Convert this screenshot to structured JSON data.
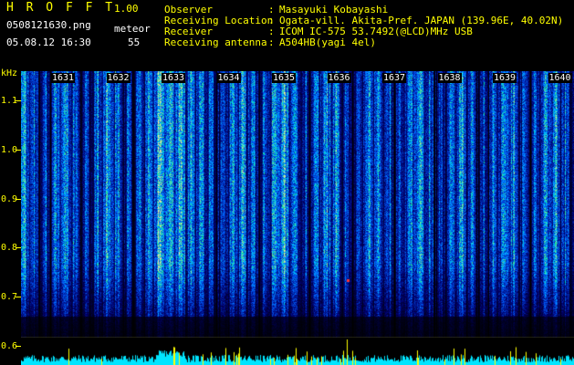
{
  "header": {
    "app_title": "H R O F F T",
    "app_version": "1.00",
    "file_name": "0508121630.png",
    "mode": "meteor",
    "timestamp": "05.08.12 16:30",
    "count": "55",
    "observer": {
      "label": "Observer",
      "value": "Masayuki Kobayashi"
    },
    "location": {
      "label": "Receiving Location",
      "value": "Ogata-vill. Akita-Pref. JAPAN (139.96E, 40.02N)"
    },
    "receiver": {
      "label": "Receiver",
      "value": "ICOM IC-575 53.7492(@LCD)MHz USB"
    },
    "antenna": {
      "label": "Receiving antenna",
      "value": "A504HB(yagi 4el)"
    }
  },
  "y_axis": {
    "unit": "kHz",
    "ticks": [
      {
        "label": "1.1",
        "value": 1.1
      },
      {
        "label": "1.0",
        "value": 1.0
      },
      {
        "label": "0.9",
        "value": 0.9
      },
      {
        "label": "0.8",
        "value": 0.8
      },
      {
        "label": "0.7",
        "value": 0.7
      },
      {
        "label": "0.6",
        "value": 0.6
      }
    ]
  },
  "time_axis": {
    "labels": [
      "1631",
      "1632",
      "1633",
      "1634",
      "1635",
      "1636",
      "1637",
      "1638",
      "1639",
      "1640"
    ]
  },
  "colors": {
    "text": "#ffff00",
    "value_text": "#ffffff",
    "background": "#000000",
    "signal_trace": "#00e5ff",
    "signal_peak": "#ffff00"
  }
}
